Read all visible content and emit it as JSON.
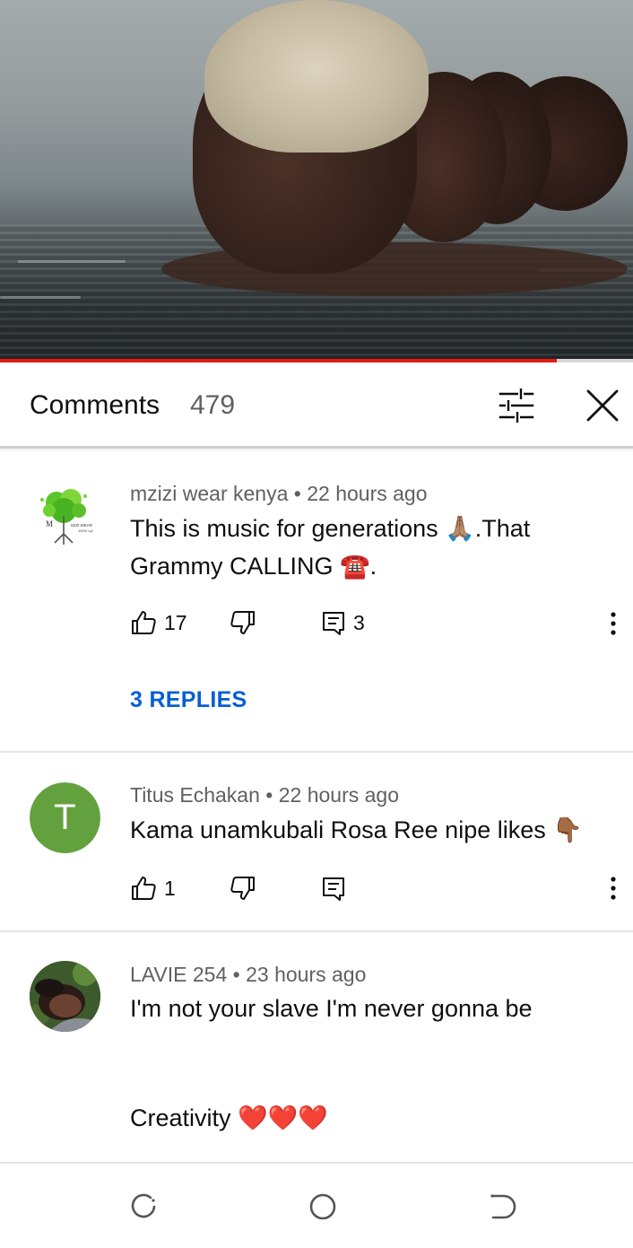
{
  "video": {
    "progress_fraction": 0.88
  },
  "header": {
    "title": "Comments",
    "count": "479",
    "filter_icon": "tune-sliders-icon",
    "close_icon": "close-icon"
  },
  "comments": [
    {
      "author": "mzizi wear kenya",
      "separator": "•",
      "time": "22 hours ago",
      "text": "This is music for generations 🙏🏽.That Grammy CALLING ☎️.",
      "likes": "17",
      "replies": "3",
      "replies_link": "3 REPLIES",
      "avatar": "mzizi-wear-logo"
    },
    {
      "author": "Titus Echakan",
      "separator": "•",
      "time": "22 hours ago",
      "text": "Kama unamkubali Rosa Ree nipe likes 👇🏾",
      "likes": "1",
      "avatar_letter": "T",
      "avatar_color": "#63a13f"
    },
    {
      "author": "LAVIE 254",
      "separator": "•",
      "time": "23 hours ago",
      "text_line1": "I'm not your slave I'm never gonna be",
      "text_line2": "Creativity ❤️❤️❤️",
      "avatar": "profile-photo"
    }
  ],
  "colors": {
    "accent_link": "#065fd4",
    "progress": "#e01b12",
    "meta_text": "#606060"
  },
  "navbar": {
    "icons": [
      "recent-apps-icon",
      "home-icon",
      "back-icon"
    ]
  }
}
